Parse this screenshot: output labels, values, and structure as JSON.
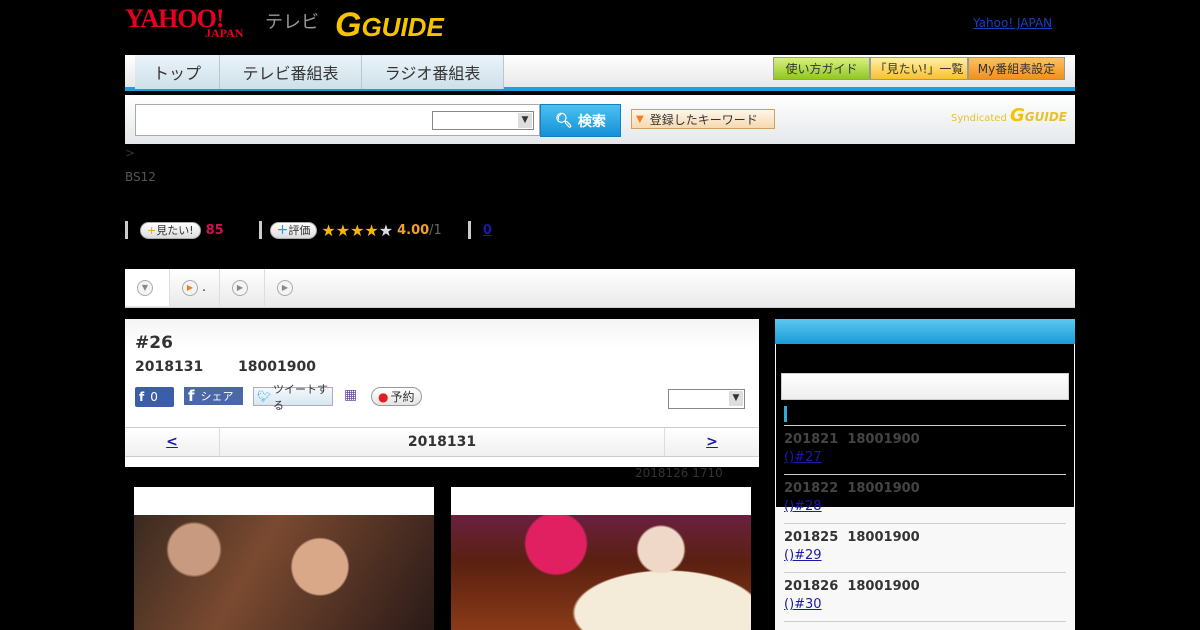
{
  "header": {
    "logo_yahoo": "YAHOO!",
    "logo_japan": "JAPAN",
    "logo_tv": "テレビ",
    "logo_gguide": "GUIDE",
    "yahoo_japan_link": "Yahoo! JAPAN"
  },
  "nav": {
    "tabs": [
      "トップ",
      "テレビ番組表",
      "ラジオ番組表"
    ],
    "guide_buttons": [
      "使い方ガイド",
      "「見たい!」一覧",
      "My番組表設定"
    ]
  },
  "search": {
    "input_value": "",
    "select_value": "",
    "button": "検索",
    "keyword_button": "登録したキーワード",
    "syndicated": "Syndicated",
    "gguide": "GUIDE"
  },
  "breadcrumb": ">",
  "channel": "BS12",
  "stats": {
    "want_label": "見たい!",
    "want_count": "85",
    "rate_label": "評価",
    "rating": 4.0,
    "rating_text": "4.00",
    "rating_count": "/1",
    "review_link": "0"
  },
  "sub_tabs": [
    {
      "icon": "down-circle"
    },
    {
      "icon": "play-circle",
      "label": "."
    },
    {
      "icon": "play-circle"
    },
    {
      "icon": "play-circle"
    }
  ],
  "program": {
    "title": "#26",
    "date": "2018131",
    "time": "18001900",
    "fb_count": "0",
    "fb_share": "シェア",
    "tweet": "ツイートする",
    "reserve": "予約",
    "select_value": ""
  },
  "pager": {
    "prev": "<",
    "current": "2018131",
    "next": ">"
  },
  "updated": "2018126  1710",
  "sidebar": {
    "episodes": [
      {
        "date": "201821",
        "time": "18001900",
        "link": "()#27"
      },
      {
        "date": "201822",
        "time": "18001900",
        "link": "()#28"
      },
      {
        "date": "201825",
        "time": "18001900",
        "link": "()#29"
      },
      {
        "date": "201826",
        "time": "18001900",
        "link": "()#30"
      }
    ]
  },
  "colors": {
    "accent": "#1ea0dc",
    "want": "#d0104c",
    "rating": "#f0a030",
    "link": "#1a1aa6"
  }
}
